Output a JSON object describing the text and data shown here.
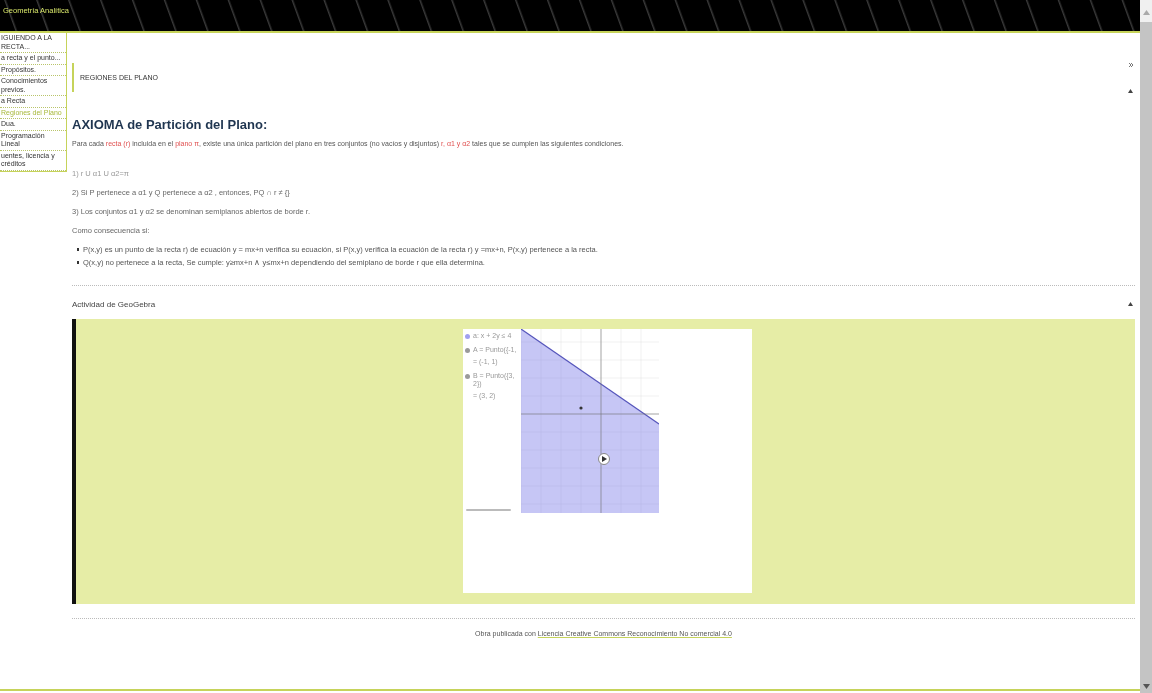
{
  "header": {
    "title": "Geometría Analítica"
  },
  "sidebar": {
    "items": [
      {
        "label": "IGUIENDO A LA RECTA...",
        "selected": false
      },
      {
        "label": "a recta y el punto...",
        "selected": false
      },
      {
        "label": "Propósitos.",
        "selected": false
      },
      {
        "label": "Conocimientos previos.",
        "selected": false
      },
      {
        "label": "a Recta",
        "selected": false
      },
      {
        "label": "Regiones del Plano",
        "selected": true
      },
      {
        "label": "Dua.",
        "selected": false
      },
      {
        "label": "Programación Lineal",
        "selected": false
      },
      {
        "label": "uentes, licencia y créditos",
        "selected": false
      }
    ]
  },
  "section": {
    "title": "REGIONES DEL PLANO"
  },
  "axiom": {
    "heading": "AXIOMA de Partición del Plano:",
    "intro": [
      {
        "kind": "plain",
        "text": "Para cada "
      },
      {
        "kind": "term",
        "text": "recta (r)"
      },
      {
        "kind": "plain",
        "text": " incluida en el "
      },
      {
        "kind": "term",
        "text": "plano π"
      },
      {
        "kind": "plain",
        "text": ", existe una única partición del plano en tres conjuntos (no vacíos y disjuntos) "
      },
      {
        "kind": "term",
        "text": "r, α1 y α2"
      },
      {
        "kind": "plain",
        "text": " tales que se cumplen las siguientes condiciones."
      }
    ],
    "conditions": [
      "1)  r U α1 U α2=π",
      "2) Si P pertenece a α1  y Q pertenece a α2 , entonces, PQ ∩  r ≠ {}",
      "3) Los conjuntos α1 y α2 se denominan semiplanos abiertos de borde r."
    ],
    "consequence": "Como consecuencia si:",
    "bullets": [
      "P(x,y) es un punto de la recta r) de ecuación y = mx+n verifica su ecuación, si P(x,y) verifica la ecuación de la recta r) y =mx+n, P(x,y) pertenece a la recta.",
      "Q(x,y) no pertenece a la recta, Se cumple: y≥mx+n  ∧ y≤mx+n dependiendo del semiplano de borde r que ella determina."
    ]
  },
  "activity": {
    "title": "Actividad de GeoGebra",
    "algebra": [
      {
        "lines": [
          "a: x + 2y ≤ 4"
        ],
        "color": "#a0a0f0"
      },
      {
        "lines": [
          "A = Punto({-1,",
          "= (-1, 1)"
        ],
        "color": "#9a9a9a"
      },
      {
        "lines": [
          "B = Punto({3, 2})",
          "= (3, 2)"
        ],
        "color": "#9a9a9a"
      }
    ]
  },
  "footer": {
    "text": "Obra publicada con",
    "link": "Licencia Creative Commons Reconocimiento No comercial 4.0"
  }
}
